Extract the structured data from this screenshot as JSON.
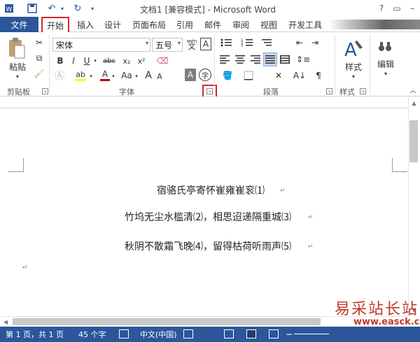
{
  "window": {
    "title": "文档1 [兼容模式] - Microsoft Word",
    "help": "?"
  },
  "tabs": {
    "file": "文件",
    "items": [
      "开始",
      "插入",
      "设计",
      "页面布局",
      "引用",
      "邮件",
      "审阅",
      "视图",
      "开发工具"
    ],
    "active": "开始"
  },
  "ribbon": {
    "clipboard": {
      "paste": "粘贴",
      "label": "剪贴板"
    },
    "font": {
      "name": "宋体",
      "size": "五号",
      "phonetic": "wén",
      "label": "字体",
      "row2": [
        "B",
        "I",
        "U",
        "abc",
        "x₂",
        "x²"
      ],
      "grow": "A",
      "shrink": "A",
      "case": "Aa",
      "highlight_color": "#ffff00",
      "font_color": "#c00000"
    },
    "paragraph": {
      "label": "段落"
    },
    "styles": {
      "button": "样式",
      "label": "样式"
    },
    "editing": {
      "button": "编辑"
    }
  },
  "document": {
    "lines": [
      "宿骆氏亭寄怀崔雍崔衮⑴",
      "竹坞无尘水槛清⑵，相思迢递隔重城⑶",
      "秋阴不散霜飞晚⑷，留得枯荷听雨声⑸"
    ],
    "para_mark": "↵"
  },
  "status": {
    "page": "第 1 页，共 1 页",
    "words": "45 个字",
    "language": "中文(中国)"
  },
  "watermark": {
    "cn": "易采站长站",
    "url": "www.easck.com"
  },
  "colors": {
    "brand": "#2b579a",
    "highlight_box": "#d3282b"
  }
}
